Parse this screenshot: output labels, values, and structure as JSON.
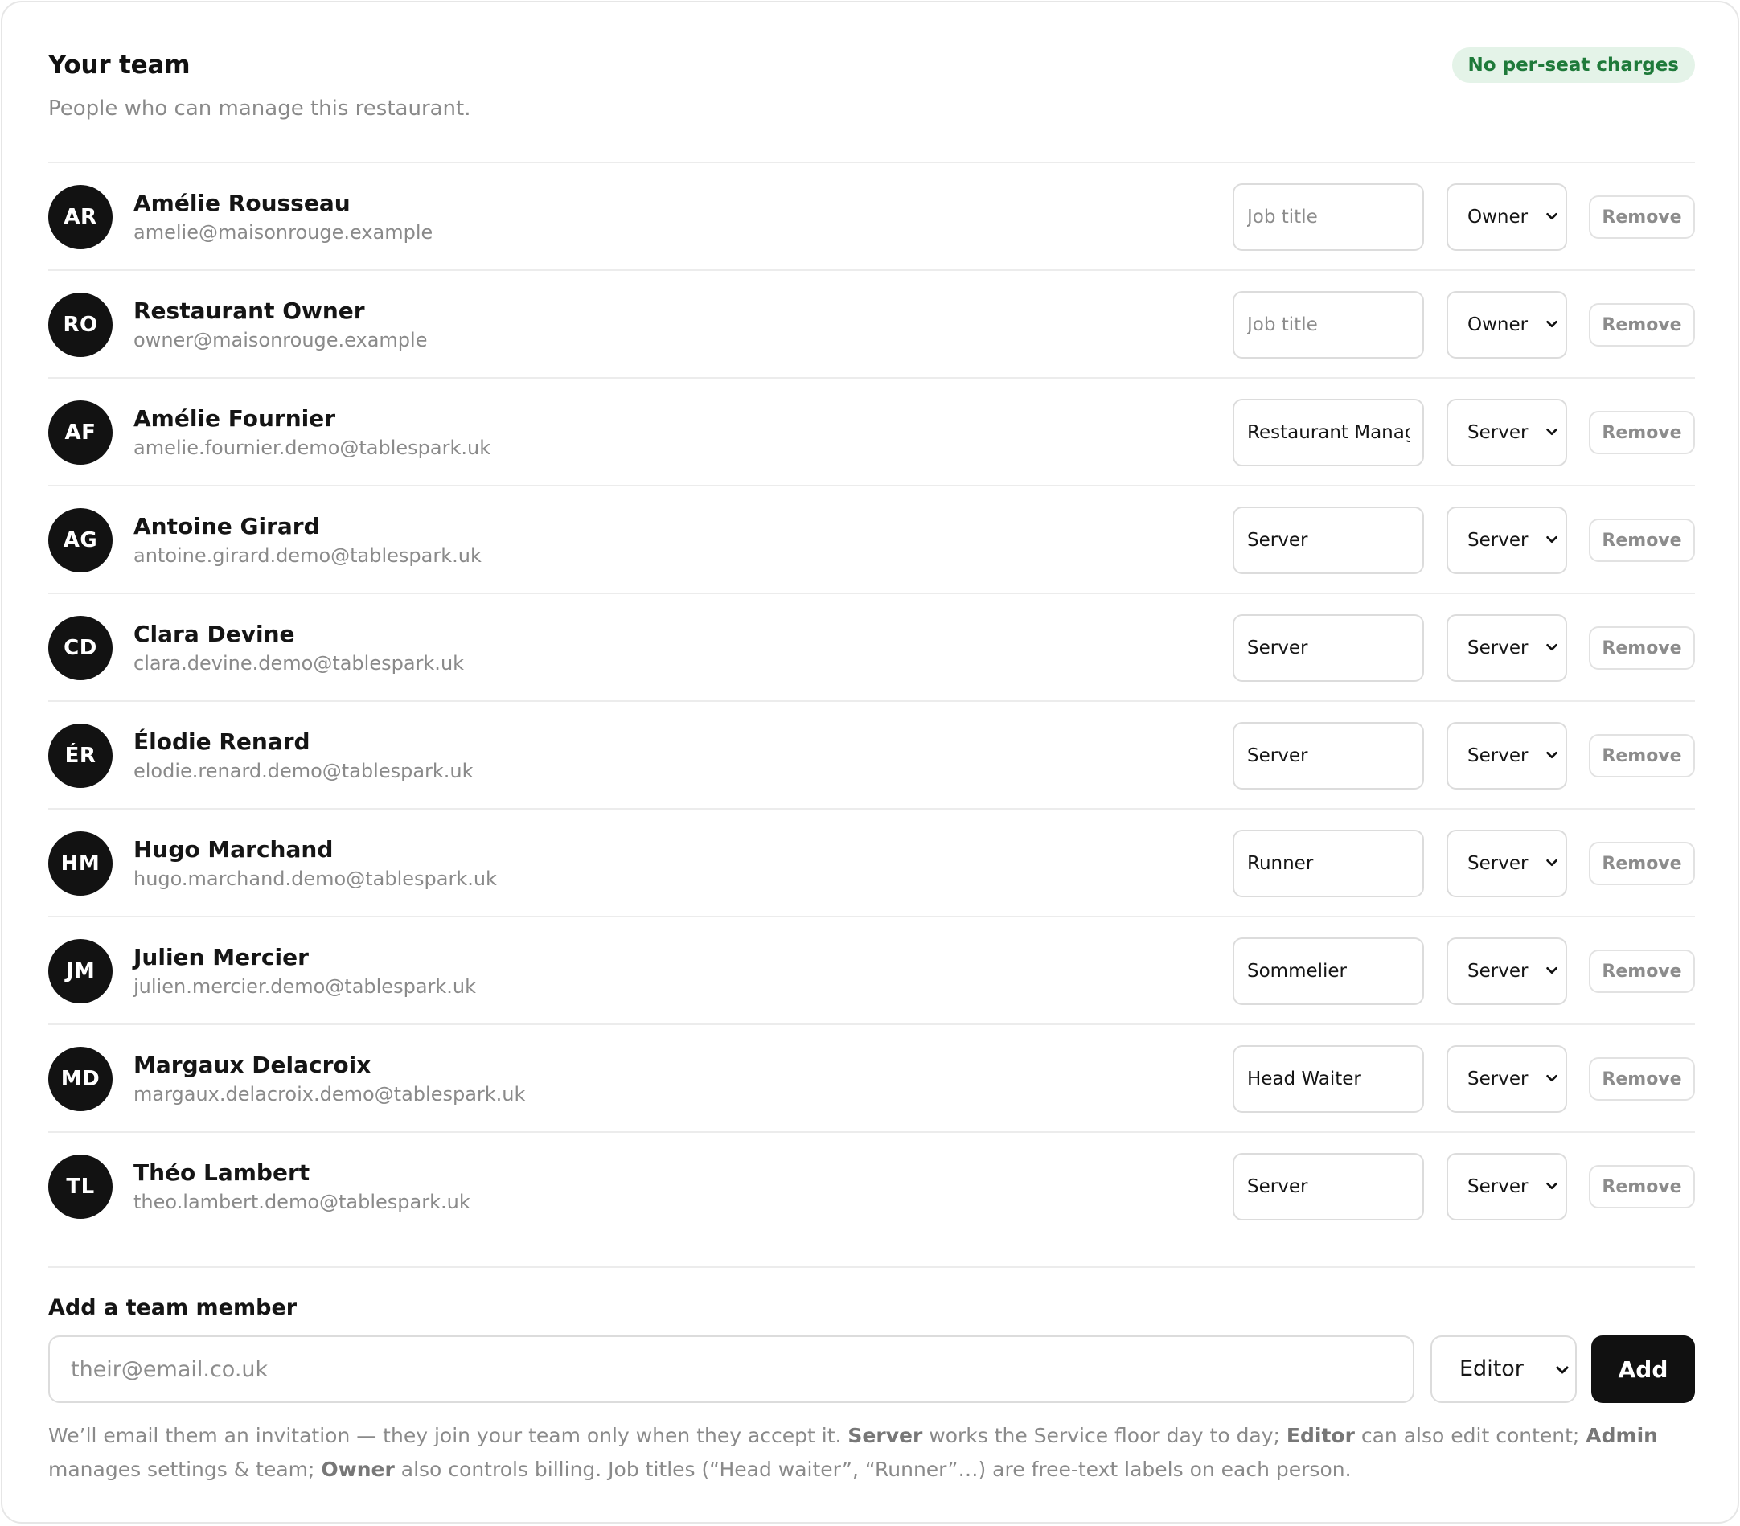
{
  "header": {
    "title": "Your team",
    "subtitle": "People who can manage this restaurant.",
    "badge": "No per-seat charges"
  },
  "job_title_placeholder": "Job title",
  "remove_label": "Remove",
  "members": [
    {
      "initials": "AR",
      "name": "Amélie Rousseau",
      "email": "amelie@maisonrouge.example",
      "job_title": "",
      "role": "Owner"
    },
    {
      "initials": "RO",
      "name": "Restaurant Owner",
      "email": "owner@maisonrouge.example",
      "job_title": "",
      "role": "Owner"
    },
    {
      "initials": "AF",
      "name": "Amélie Fournier",
      "email": "amelie.fournier.demo@tablespark.uk",
      "job_title": "Restaurant Manager",
      "role": "Server"
    },
    {
      "initials": "AG",
      "name": "Antoine Girard",
      "email": "antoine.girard.demo@tablespark.uk",
      "job_title": "Server",
      "role": "Server"
    },
    {
      "initials": "CD",
      "name": "Clara Devine",
      "email": "clara.devine.demo@tablespark.uk",
      "job_title": "Server",
      "role": "Server"
    },
    {
      "initials": "ÉR",
      "name": "Élodie Renard",
      "email": "elodie.renard.demo@tablespark.uk",
      "job_title": "Server",
      "role": "Server"
    },
    {
      "initials": "HM",
      "name": "Hugo Marchand",
      "email": "hugo.marchand.demo@tablespark.uk",
      "job_title": "Runner",
      "role": "Server"
    },
    {
      "initials": "JM",
      "name": "Julien Mercier",
      "email": "julien.mercier.demo@tablespark.uk",
      "job_title": "Sommelier",
      "role": "Server"
    },
    {
      "initials": "MD",
      "name": "Margaux Delacroix",
      "email": "margaux.delacroix.demo@tablespark.uk",
      "job_title": "Head Waiter",
      "role": "Server"
    },
    {
      "initials": "TL",
      "name": "Théo Lambert",
      "email": "theo.lambert.demo@tablespark.uk",
      "job_title": "Server",
      "role": "Server"
    }
  ],
  "add_member": {
    "heading": "Add a team member",
    "email_placeholder": "their@email.co.uk",
    "role": "Editor",
    "button_label": "Add",
    "help": {
      "intro": "We’ll email them an invitation — they join your team only when they accept it. ",
      "server_term": "Server",
      "server_desc": " works the Service floor day to day; ",
      "editor_term": "Editor",
      "editor_desc": " can also edit content; ",
      "admin_term": "Admin",
      "admin_desc": " manages settings & team; ",
      "owner_term": "Owner",
      "owner_desc": " also controls billing. Job titles (“Head waiter”, “Runner”…) are free-text labels on each person."
    }
  },
  "colors": {
    "badge_bg": "#e4f3e8",
    "badge_text": "#1f7a3a",
    "avatar_bg": "#121212",
    "primary_button": "#111111"
  }
}
